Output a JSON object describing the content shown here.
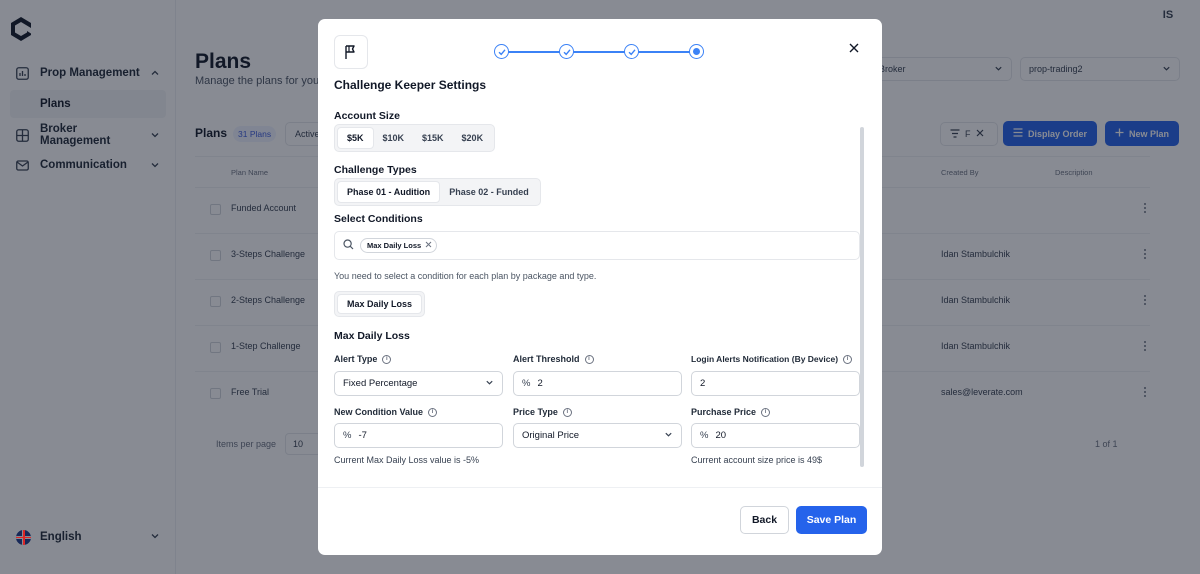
{
  "sidebar": {
    "items": [
      {
        "label": "Prop Management",
        "icon": "chart-icon"
      },
      {
        "label": "Plans"
      },
      {
        "label": "Broker Management",
        "icon": "grid-icon"
      },
      {
        "label": "Communication",
        "icon": "mail-icon"
      }
    ],
    "language": "English"
  },
  "header": {
    "avatar_initials": "IS"
  },
  "page": {
    "title": "Plans",
    "subtitle": "Manage the plans for your",
    "broker_select": "Broker",
    "server_select": "prop-trading2"
  },
  "toolbar": {
    "plans_label": "Plans",
    "plans_count": "31 Plans",
    "active_filter": "Active",
    "filter_label": "F",
    "display_order": "Display Order",
    "new_plan": "New Plan"
  },
  "table": {
    "columns": {
      "plan_name": "Plan Name",
      "created_by": "Created By",
      "description": "Description"
    },
    "rows": [
      {
        "name": "Funded Account",
        "created_by": ""
      },
      {
        "name": "3-Steps Challenge",
        "created_by": "Idan Stambulchik"
      },
      {
        "name": "2-Steps Challenge",
        "created_by": "Idan Stambulchik"
      },
      {
        "name": "1-Step Challenge",
        "created_by": "Idan Stambulchik"
      },
      {
        "name": "Free Trial",
        "created_by": "sales@leverate.com"
      }
    ],
    "items_per_page_label": "Items per page",
    "items_per_page": "10",
    "pagination": "1 of 1"
  },
  "modal": {
    "title": "Challenge Keeper Settings",
    "stepper": {
      "total_steps": 4,
      "current_step": 4
    },
    "account_size": {
      "label": "Account Size",
      "options": [
        "$5K",
        "$10K",
        "$15K",
        "$20K"
      ],
      "selected": "$5K"
    },
    "challenge_types": {
      "label": "Challenge Types",
      "options": [
        "Phase 01 - Audition",
        "Phase 02 - Funded"
      ],
      "selected": "Phase 01 - Audition"
    },
    "select_conditions": {
      "label": "Select Conditions",
      "tags": [
        "Max Daily Loss"
      ],
      "hint": "You need to select a condition for each plan by package and type."
    },
    "condition_tab": "Max Daily Loss",
    "section_title": "Max Daily Loss",
    "fields": {
      "alert_type": {
        "label": "Alert Type",
        "value": "Fixed Percentage"
      },
      "alert_threshold": {
        "label": "Alert Threshold",
        "prefix": "%",
        "value": "2"
      },
      "login_alerts": {
        "label": "Login Alerts Notification (By Device)",
        "value": "2"
      },
      "new_condition_value": {
        "label": "New Condition Value",
        "prefix": "%",
        "value": "-7"
      },
      "price_type": {
        "label": "Price Type",
        "value": "Original Price"
      },
      "purchase_price": {
        "label": "Purchase Price",
        "prefix": "%",
        "value": "20"
      }
    },
    "notes": {
      "current_mdl": "Current Max Daily Loss value is -5%",
      "current_price": "Current account size price is 49$"
    },
    "buttons": {
      "back": "Back",
      "save": "Save Plan"
    }
  },
  "colors": {
    "accent": "#2563eb",
    "step": "#3b82f6"
  }
}
